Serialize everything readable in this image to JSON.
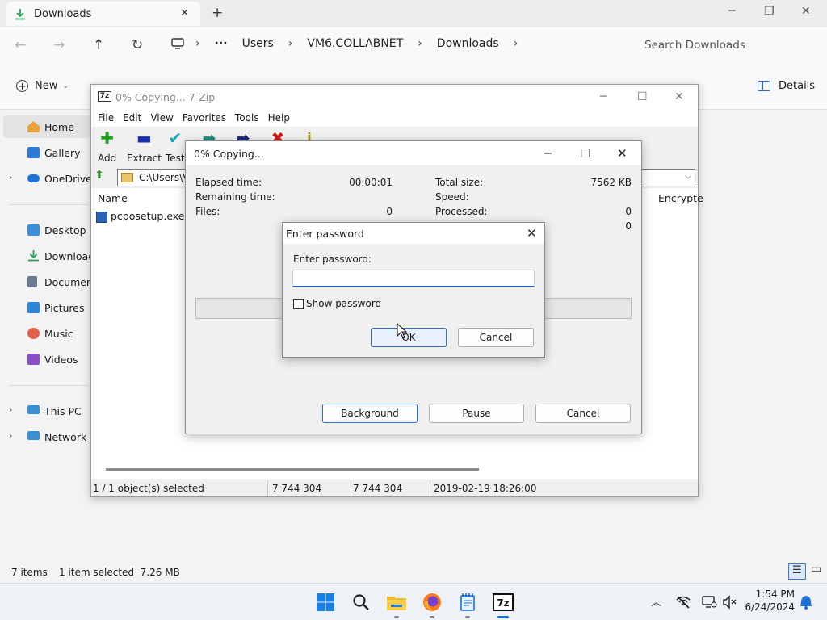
{
  "explorer": {
    "tab_title": "Downloads",
    "new_tab": "+",
    "breadcrumbs": [
      "Users",
      "VM6.COLLABNET",
      "Downloads"
    ],
    "search_placeholder": "Search Downloads",
    "new_label": "New",
    "details_label": "Details",
    "sidebar": {
      "items": [
        {
          "label": "Home",
          "icon": "home-icon",
          "color": "#e8a33d"
        },
        {
          "label": "Gallery",
          "icon": "gallery-icon",
          "color": "#2f7ad6"
        },
        {
          "label": "OneDrive",
          "icon": "cloud-icon",
          "color": "#1a73d9"
        },
        {
          "label": "Desktop",
          "icon": "desktop-icon",
          "color": "#3a8fd8"
        },
        {
          "label": "Downloads",
          "icon": "download-icon",
          "color": "#2a9d5a"
        },
        {
          "label": "Documents",
          "icon": "document-icon",
          "color": "#6b7a90"
        },
        {
          "label": "Pictures",
          "icon": "pictures-icon",
          "color": "#2f86d6"
        },
        {
          "label": "Music",
          "icon": "music-icon",
          "color": "#e0604e"
        },
        {
          "label": "Videos",
          "icon": "video-icon",
          "color": "#8a4fc8"
        },
        {
          "label": "This PC",
          "icon": "computer-icon",
          "color": "#3b8fd0"
        },
        {
          "label": "Network",
          "icon": "network-icon",
          "color": "#3b8fd0"
        }
      ]
    },
    "status": {
      "items": "7 items",
      "selected": "1 item selected  7.26 MB"
    }
  },
  "sevenzip": {
    "title": "0% Copying... 7-Zip",
    "logo": "7z",
    "menu": [
      "File",
      "Edit",
      "View",
      "Favorites",
      "Tools",
      "Help"
    ],
    "toolbar": [
      "Add",
      "Extract",
      "Test"
    ],
    "path": "C:\\Users\\VM",
    "columns": {
      "name": "Name",
      "encrypted": "Encrypte"
    },
    "file": "pcposetup.exe",
    "status": [
      "1 / 1 object(s) selected",
      "7 744 304",
      "7 744 304",
      "2019-02-19 18:26:00"
    ]
  },
  "copying": {
    "title": "0% Copying...",
    "elapsed_label": "Elapsed time:",
    "elapsed_value": "00:00:01",
    "remaining_label": "Remaining time:",
    "files_label": "Files:",
    "files_value": "0",
    "total_label": "Total size:",
    "total_value": "7562 KB",
    "speed_label": "Speed:",
    "processed_label": "Processed:",
    "processed_value": "0",
    "extra_value": "0",
    "buttons": {
      "background": "Background",
      "pause": "Pause",
      "cancel": "Cancel"
    }
  },
  "password": {
    "title": "Enter password",
    "label": "Enter password:",
    "value": "",
    "show_label": "Show password",
    "ok": "OK",
    "cancel": "Cancel"
  },
  "taskbar": {
    "time": "1:54 PM",
    "date": "6/24/2024"
  },
  "colors": {
    "accent": "#1f6fd1"
  }
}
